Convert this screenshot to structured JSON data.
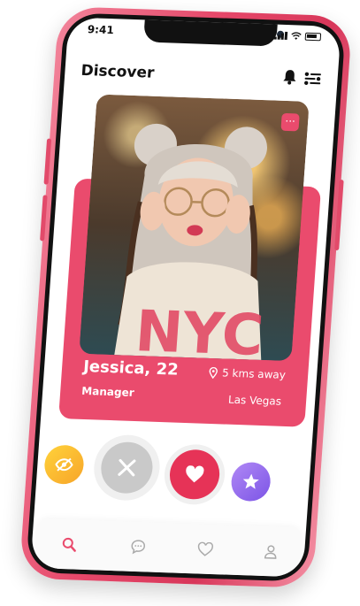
{
  "status_bar": {
    "time": "9:41"
  },
  "header": {
    "title": "Discover"
  },
  "profile": {
    "name_age": "Jessica, 22",
    "job": "Manager",
    "distance": "5 kms away",
    "city": "Las Vegas",
    "more_label": "···"
  },
  "actions": {
    "hide_icon": "eye-off-icon",
    "dismiss_icon": "close-icon",
    "like_icon": "heart-icon",
    "super_like_icon": "star-icon"
  },
  "tabbar": {
    "items": [
      "search-icon",
      "chat-icon",
      "heart-icon",
      "profile-icon"
    ],
    "active": "search-icon"
  },
  "colors": {
    "accent": "#ea4b6d",
    "like": "#e63357",
    "hide": "#f7b12a",
    "super_like": "#8b63eb",
    "dismiss": "#c9c9c9"
  }
}
